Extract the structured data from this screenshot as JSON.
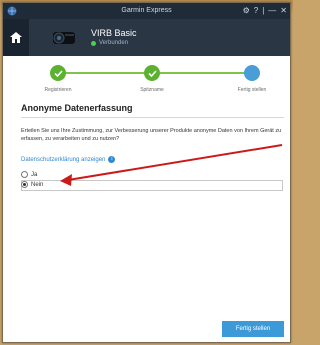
{
  "titlebar": {
    "app_title": "Garmin Express",
    "controls": [
      "⚙",
      "?",
      "|",
      "—",
      "✕"
    ]
  },
  "device": {
    "name": "VIRB Basic",
    "status": "Verbunden"
  },
  "steps": [
    {
      "label": "Registrieren",
      "state": "done"
    },
    {
      "label": "Spitzname",
      "state": "done"
    },
    {
      "label": "Fertig stellen",
      "state": "current"
    }
  ],
  "content": {
    "heading": "Anonyme Datenerfassung",
    "paragraph": "Erteilen Sie uns Ihre Zustimmung, zur Verbesserung unserer Produkte anonyme Daten von Ihrem Gerät zu erfassen, zu verarbeiten und zu nutzen?",
    "privacy_link": "Datenschutzerklärung anzeigen",
    "options": {
      "yes": "Ja",
      "no": "Nein",
      "selected": "no"
    }
  },
  "footer": {
    "finish_button": "Fertig stellen"
  },
  "colors": {
    "accent": "#3d9ad8",
    "success": "#5bb130",
    "header": "#2a3644",
    "annotation_arrow": "#cc1a1a"
  }
}
